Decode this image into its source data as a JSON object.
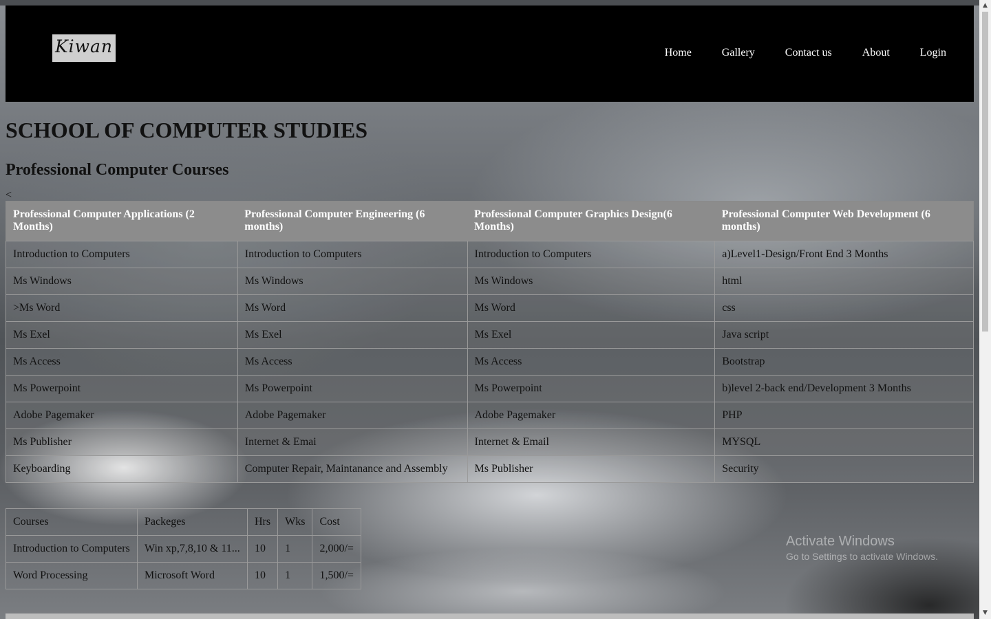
{
  "brand": {
    "logo_text": "Kiwan"
  },
  "nav": {
    "items": [
      {
        "label": "Home"
      },
      {
        "label": "Gallery"
      },
      {
        "label": "Contact us"
      },
      {
        "label": "About"
      },
      {
        "label": "Login"
      }
    ]
  },
  "main": {
    "title": "SCHOOL OF COMPUTER STUDIES",
    "subtitle": "Professional Computer Courses",
    "stray_char": "<"
  },
  "courses_table": {
    "headers": [
      "Professional Computer Applications (2 Months)",
      "Professional Computer Engineering (6 months)",
      "Professional Computer Graphics Design(6 Months)",
      "Professional Computer Web Development (6 months)"
    ],
    "rows": [
      [
        "Introduction to Computers",
        "Introduction to Computers",
        "Introduction to Computers",
        "a)Level1-Design/Front End 3 Months"
      ],
      [
        "Ms Windows",
        "Ms Windows",
        "Ms Windows",
        "html"
      ],
      [
        ">Ms Word",
        "Ms Word",
        "Ms Word",
        "css"
      ],
      [
        "Ms Exel",
        "Ms Exel",
        "Ms Exel",
        "Java script"
      ],
      [
        "Ms Access",
        "Ms Access",
        "Ms Access",
        "Bootstrap"
      ],
      [
        "Ms Powerpoint",
        "Ms Powerpoint",
        "Ms Powerpoint",
        "b)level 2-back end/Development 3 Months"
      ],
      [
        "Adobe Pagemaker",
        "Adobe Pagemaker",
        "Adobe Pagemaker",
        "PHP"
      ],
      [
        "Ms Publisher",
        "Internet & Emai",
        "Internet & Email",
        "MYSQL"
      ],
      [
        "Keyboarding",
        "Computer Repair, Maintanance and Assembly",
        "Ms Publisher",
        "Security"
      ]
    ]
  },
  "fees_table": {
    "headers": [
      "Courses",
      "Packeges",
      "Hrs",
      "Wks",
      "Cost"
    ],
    "rows": [
      [
        "Introduction to Computers",
        "Win xp,7,8,10 & 11...",
        "10",
        "1",
        "2,000/="
      ],
      [
        "Word Processing",
        "Microsoft Word",
        "10",
        "1",
        "1,500/="
      ]
    ]
  },
  "watermark": {
    "title": "Activate Windows",
    "subtitle": "Go to Settings to activate Windows."
  }
}
